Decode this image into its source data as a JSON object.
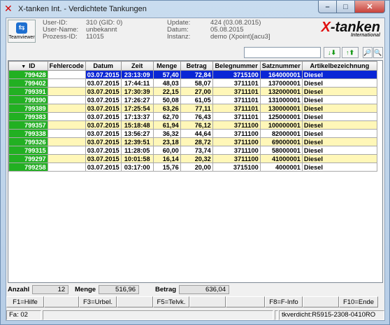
{
  "window": {
    "title": "X-tanken Int. - Verdichtete Tankungen"
  },
  "header": {
    "teamviewer_label": "Teamviewer",
    "user_id_label": "User-ID:",
    "user_id": "310 (GID: 0)",
    "user_name_label": "User-Name:",
    "user_name": "unbekannt",
    "process_id_label": "Prozess-ID:",
    "process_id": "11015",
    "update_label": "Update:",
    "update": "424 (03.08.2015)",
    "date_label": "Datum:",
    "date": "05.08.2015",
    "instance_label": "Instanz:",
    "instance": "demo (Xpoint)[acu3]",
    "brand_prefix": "X",
    "brand_rest": "-tanken",
    "brand_sub": "International"
  },
  "toolbar": {
    "search_value": "",
    "btn_sort_asc": "↓⬇",
    "btn_sort_desc": "↑⬆",
    "btn_find": "🔎",
    "btn_find_next": "🔍"
  },
  "table": {
    "columns": [
      "ID",
      "Fehlercode",
      "Datum",
      "Zeit",
      "Menge",
      "Betrag",
      "Belegnummer",
      "Satznummer",
      "Artikelbezeichnung"
    ],
    "rows": [
      {
        "id": "799428",
        "fehlercode": "",
        "datum": "03.07.2015",
        "zeit": "23:13:09",
        "menge": "57,40",
        "betrag": "72,84",
        "beleg": "3715100",
        "satz": "164000001",
        "artikel": "Diesel"
      },
      {
        "id": "799402",
        "fehlercode": "",
        "datum": "03.07.2015",
        "zeit": "17:44:11",
        "menge": "48,03",
        "betrag": "58,07",
        "beleg": "3711101",
        "satz": "137000001",
        "artikel": "Diesel"
      },
      {
        "id": "799391",
        "fehlercode": "",
        "datum": "03.07.2015",
        "zeit": "17:30:39",
        "menge": "22,15",
        "betrag": "27,00",
        "beleg": "3711101",
        "satz": "132000001",
        "artikel": "Diesel"
      },
      {
        "id": "799390",
        "fehlercode": "",
        "datum": "03.07.2015",
        "zeit": "17:26:27",
        "menge": "50,08",
        "betrag": "61,05",
        "beleg": "3711101",
        "satz": "131000001",
        "artikel": "Diesel"
      },
      {
        "id": "799389",
        "fehlercode": "",
        "datum": "03.07.2015",
        "zeit": "17:25:54",
        "menge": "63,26",
        "betrag": "77,11",
        "beleg": "3711101",
        "satz": "130000001",
        "artikel": "Diesel"
      },
      {
        "id": "799383",
        "fehlercode": "",
        "datum": "03.07.2015",
        "zeit": "17:13:37",
        "menge": "62,70",
        "betrag": "76,43",
        "beleg": "3711101",
        "satz": "125000001",
        "artikel": "Diesel"
      },
      {
        "id": "799357",
        "fehlercode": "",
        "datum": "03.07.2015",
        "zeit": "15:18:48",
        "menge": "61,94",
        "betrag": "76,12",
        "beleg": "3711100",
        "satz": "100000001",
        "artikel": "Diesel"
      },
      {
        "id": "799338",
        "fehlercode": "",
        "datum": "03.07.2015",
        "zeit": "13:56:27",
        "menge": "36,32",
        "betrag": "44,64",
        "beleg": "3711100",
        "satz": "82000001",
        "artikel": "Diesel"
      },
      {
        "id": "799326",
        "fehlercode": "",
        "datum": "03.07.2015",
        "zeit": "12:39:51",
        "menge": "23,18",
        "betrag": "28,72",
        "beleg": "3711100",
        "satz": "69000001",
        "artikel": "Diesel"
      },
      {
        "id": "799315",
        "fehlercode": "",
        "datum": "03.07.2015",
        "zeit": "11:28:05",
        "menge": "60,00",
        "betrag": "73,74",
        "beleg": "3711100",
        "satz": "58000001",
        "artikel": "Diesel"
      },
      {
        "id": "799297",
        "fehlercode": "",
        "datum": "03.07.2015",
        "zeit": "10:01:58",
        "menge": "16,14",
        "betrag": "20,32",
        "beleg": "3711100",
        "satz": "41000001",
        "artikel": "Diesel"
      },
      {
        "id": "799258",
        "fehlercode": "",
        "datum": "03.07.2015",
        "zeit": "03:17:00",
        "menge": "15,76",
        "betrag": "20,00",
        "beleg": "3715100",
        "satz": "4000001",
        "artikel": "Diesel"
      }
    ]
  },
  "totals": {
    "anzahl_label": "Anzahl",
    "anzahl": "12",
    "menge_label": "Menge",
    "menge": "516,96",
    "betrag_label": "Betrag",
    "betrag": "636,04"
  },
  "fkeys": [
    "F1=Hilfe",
    "",
    "F3=Urbel.",
    "",
    "F5=Telvk.",
    "",
    "",
    "F8=F-Info",
    "",
    "F10=Ende"
  ],
  "status": {
    "fa": "Fa: 02",
    "left2": "",
    "mid": "",
    "right": "tkverdicht:R5915-2308-0410RO"
  },
  "colors": {
    "id_cell": "#22b022",
    "selected_row": "#0a26d6",
    "alt_row": "#fff7b8"
  }
}
